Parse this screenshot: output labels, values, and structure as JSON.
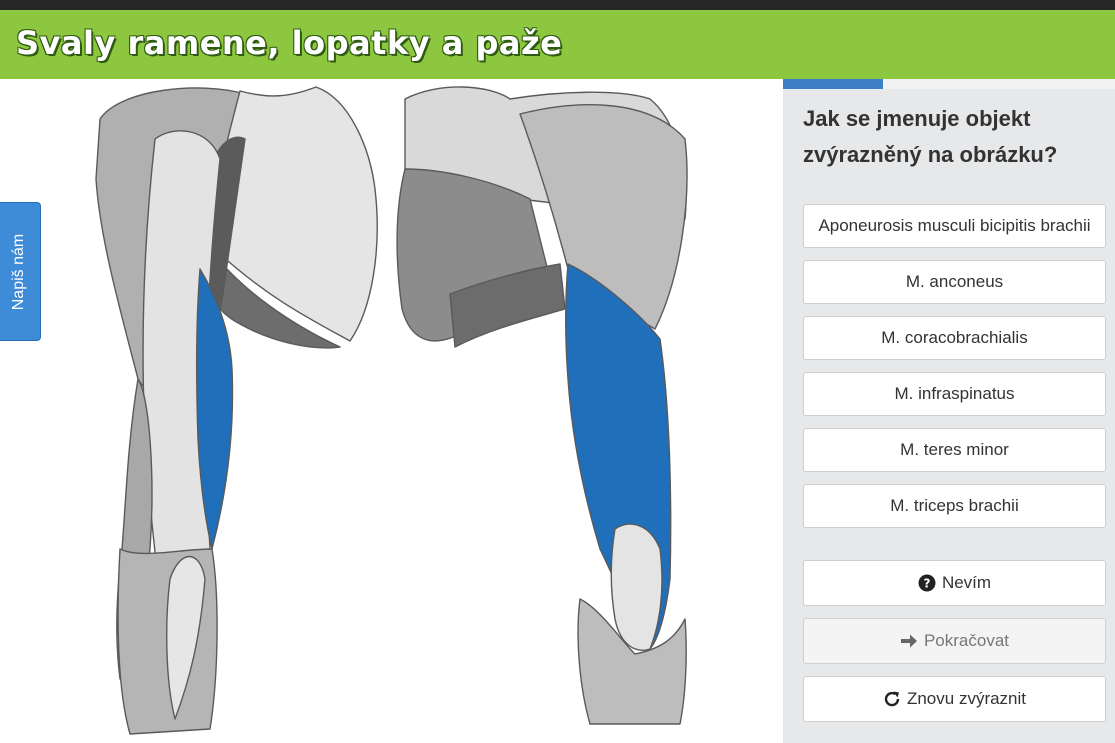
{
  "header": {
    "title": "Svaly ramene, lopatky a paže"
  },
  "feedback_tab": {
    "label": "Napiš nám"
  },
  "progress": {
    "fraction": 0.3,
    "color": "#3d7ec9"
  },
  "question": {
    "text": "Jak se jmenuje objekt zvýrazněný na obrázku?"
  },
  "options": [
    {
      "label": "Aponeurosis musculi bicipitis brachii"
    },
    {
      "label": "M. anconeus"
    },
    {
      "label": "M. coracobrachialis"
    },
    {
      "label": "M. infraspinatus"
    },
    {
      "label": "M. teres minor"
    },
    {
      "label": "M. triceps brachii"
    }
  ],
  "actions": {
    "dont_know": {
      "label": "Nevím",
      "icon": "question-circle-icon"
    },
    "continue": {
      "label": "Pokračovat",
      "icon": "arrow-right-icon",
      "disabled": true
    },
    "highlight_again": {
      "label": "Znovu zvýraznit",
      "icon": "refresh-icon"
    }
  },
  "colors": {
    "header": "#8dc63f",
    "highlight": "#1f6fbb",
    "feedback_tab": "#3e8bd8"
  }
}
